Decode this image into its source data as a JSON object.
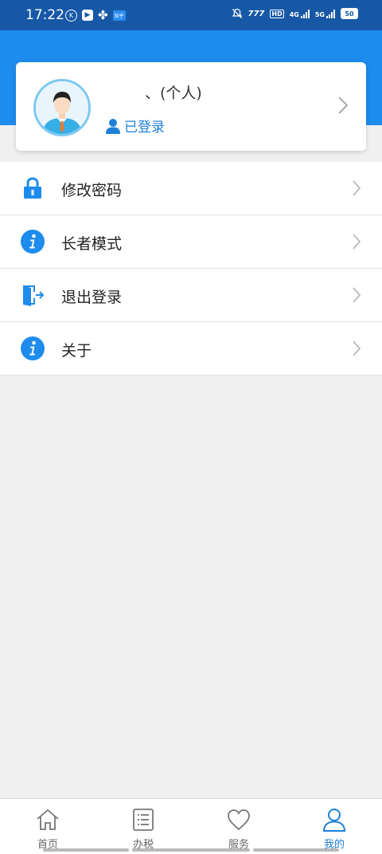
{
  "status_bar": {
    "time": "17:22",
    "network_1": "4G",
    "network_2": "5G",
    "battery": "50",
    "hd_label": "HD"
  },
  "profile": {
    "name": "、(个人)",
    "status": "已登录"
  },
  "menu": {
    "items": [
      {
        "label": "修改密码",
        "icon": "lock-icon"
      },
      {
        "label": "长者模式",
        "icon": "info-icon"
      },
      {
        "label": "退出登录",
        "icon": "exit-door-icon"
      },
      {
        "label": "关于",
        "icon": "info-icon"
      }
    ]
  },
  "tabs": [
    {
      "label": "首页",
      "icon": "home-icon",
      "active": false
    },
    {
      "label": "办税",
      "icon": "list-icon",
      "active": false
    },
    {
      "label": "服务",
      "icon": "heart-icon",
      "active": false
    },
    {
      "label": "我的",
      "icon": "user-icon",
      "active": true
    }
  ],
  "colors": {
    "brand_blue": "#1d8cec",
    "status_bar": "#1758a6",
    "active_tab": "#1d80d8"
  }
}
